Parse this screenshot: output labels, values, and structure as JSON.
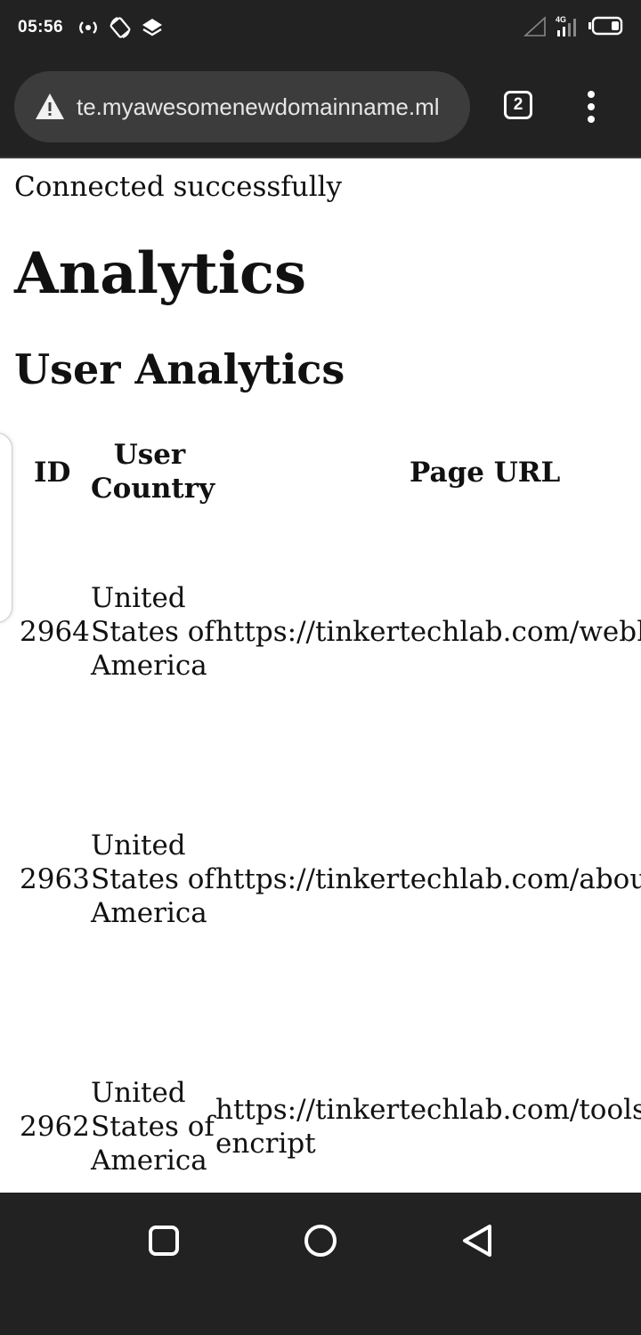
{
  "status_bar": {
    "time": "05:56",
    "left_icons": [
      "hotspot-icon",
      "auto-rotate-icon",
      "layers-icon"
    ],
    "right_icons": [
      "signal-empty-icon",
      "4g-signal-icon",
      "battery-icon"
    ],
    "network_label": "4G"
  },
  "browser": {
    "url": "te.myawesomenewdomainname.ml",
    "tab_count": "2",
    "security_icon": "warning-icon",
    "menu_icon": "more-vert-icon"
  },
  "page": {
    "status_message": "Connected successfully",
    "title": "Analytics",
    "subtitle": "User Analytics",
    "table": {
      "headers": {
        "id": "ID",
        "country": "User\nCountry",
        "url": "Page URL"
      },
      "rows": [
        {
          "id": "2964",
          "country": "United\nStates of\nAmerica",
          "url": "https://tinkertechlab.com/webhe"
        },
        {
          "id": "2963",
          "country": "United\nStates of\nAmerica",
          "url": "https://tinkertechlab.com/about"
        },
        {
          "id": "2962",
          "country": "United\nStates of\nAmerica",
          "url": "https://tinkertechlab.com/tools/s\nencript"
        }
      ]
    }
  },
  "nav_bar": {
    "buttons": [
      "recents-icon",
      "home-icon",
      "back-icon"
    ]
  }
}
